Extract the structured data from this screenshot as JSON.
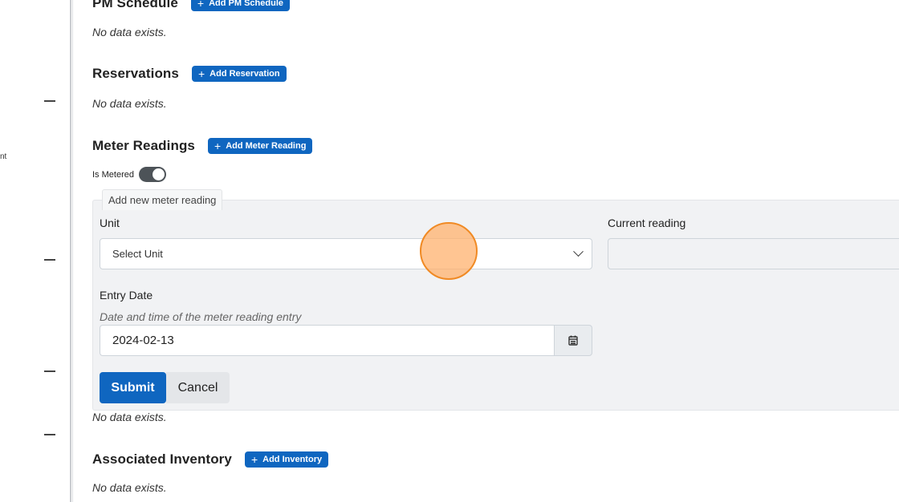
{
  "sidebar": {
    "partial_text": "nt"
  },
  "sections": {
    "pm_schedule": {
      "title": "PM Schedule",
      "add_label": "Add PM Schedule",
      "empty": "No data exists."
    },
    "reservations": {
      "title": "Reservations",
      "add_label": "Add Reservation",
      "empty": "No data exists."
    },
    "meter_readings": {
      "title": "Meter Readings",
      "add_label": "Add Meter Reading",
      "is_metered_label": "Is Metered",
      "is_metered": true,
      "empty": "No data exists."
    },
    "associated_inventory": {
      "title": "Associated Inventory",
      "add_label": "Add Inventory",
      "empty": "No data exists."
    }
  },
  "meter_form": {
    "tab_label": "Add new meter reading",
    "unit_label": "Unit",
    "unit_placeholder": "Select Unit",
    "current_reading_label": "Current reading",
    "current_reading_value": "",
    "entry_date_label": "Entry Date",
    "entry_date_help": "Date and time of the meter reading entry",
    "entry_date_value": "2024-02-13",
    "submit_label": "Submit",
    "cancel_label": "Cancel"
  },
  "colors": {
    "primary": "#0f66c0",
    "panel_bg": "#f1f2f4",
    "cursor_highlight": "#f08a24"
  }
}
